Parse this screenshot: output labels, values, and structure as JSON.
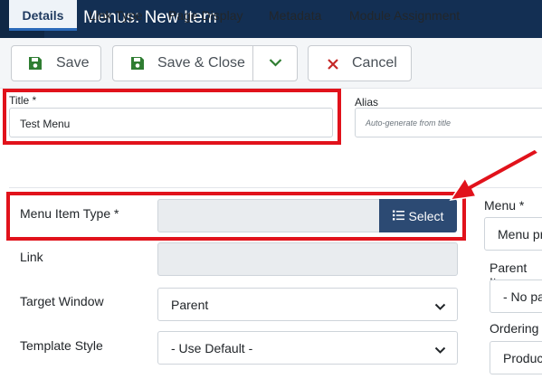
{
  "header": {
    "title": "Menus: New Item",
    "logo_icon": "joomla-logo-icon",
    "list_icon": "list-icon",
    "background": "#132f53"
  },
  "toolbar": {
    "save_label": "Save",
    "save_close_label": "Save & Close",
    "cancel_label": "Cancel",
    "save_icon": "floppy-disk-icon",
    "dropdown_icon": "chevron-down-icon",
    "cancel_icon": "close-icon",
    "save_color": "#2f7d32",
    "cancel_color": "#c52827"
  },
  "title_field": {
    "label": "Title *",
    "value": "Test Menu"
  },
  "alias_field": {
    "label": "Alias",
    "placeholder": "Auto-generate from title"
  },
  "tabs": [
    {
      "label": "Details",
      "active": true
    },
    {
      "label": "Link Type"
    },
    {
      "label": "Page Display"
    },
    {
      "label": "Metadata"
    },
    {
      "label": "Module Assignment"
    }
  ],
  "form": {
    "menu_item_type_label": "Menu Item Type *",
    "select_button_label": "Select",
    "select_icon": "list-icon",
    "link_label": "Link",
    "target_window_label": "Target Window",
    "target_window_value": "Parent",
    "template_style_label": "Template Style",
    "template_style_value": "- Use Default -"
  },
  "sidebar_right": {
    "menu_label": "Menu *",
    "menu_value": "Menu pr",
    "parent_label": "Parent Ite",
    "parent_value": "- No pa",
    "ordering_label": "Ordering",
    "ordering_value": "Produc"
  },
  "highlight_color": "#e1121b"
}
